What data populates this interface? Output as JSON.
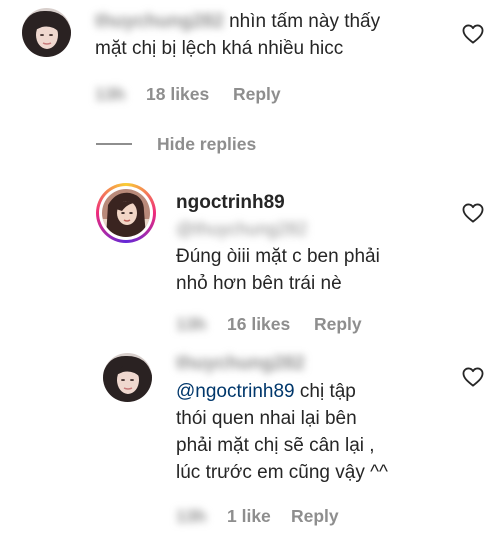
{
  "comment1": {
    "username": "thuychung282",
    "text_line1": "nhìn tấm này thấy",
    "text_line2": "mặt chị bị lệch khá nhiều hicc",
    "time": "13h",
    "likes": "18 likes",
    "reply": "Reply"
  },
  "hide_replies": "Hide replies",
  "reply1": {
    "username": "ngoctrinh89",
    "mention": "@thuychung282",
    "text_line1": "Đúng òiii mặt c ben phải",
    "text_line2": "nhỏ hơn bên trái nè",
    "time": "13h",
    "likes": "16 likes",
    "reply": "Reply"
  },
  "reply2": {
    "username": "thuychung282",
    "mention": "@ngoctrinh89",
    "text_line1_rest": " chị tập",
    "text_line2": "thói quen nhai lại bên",
    "text_line3": "phải mặt chị sẽ cân lại ,",
    "text_line4": "lúc trước em cũng vậy ^^",
    "time": "13h",
    "likes": "1 like",
    "reply": "Reply"
  },
  "icons": {
    "like": "heart-icon",
    "avatar": "profile-photo"
  },
  "colors": {
    "text": "#262626",
    "secondary": "#8e8e8e",
    "mention": "#00376b",
    "story_ring_start": "#f9ce34",
    "story_ring_mid": "#ee2a7b",
    "story_ring_end": "#6228d7"
  }
}
